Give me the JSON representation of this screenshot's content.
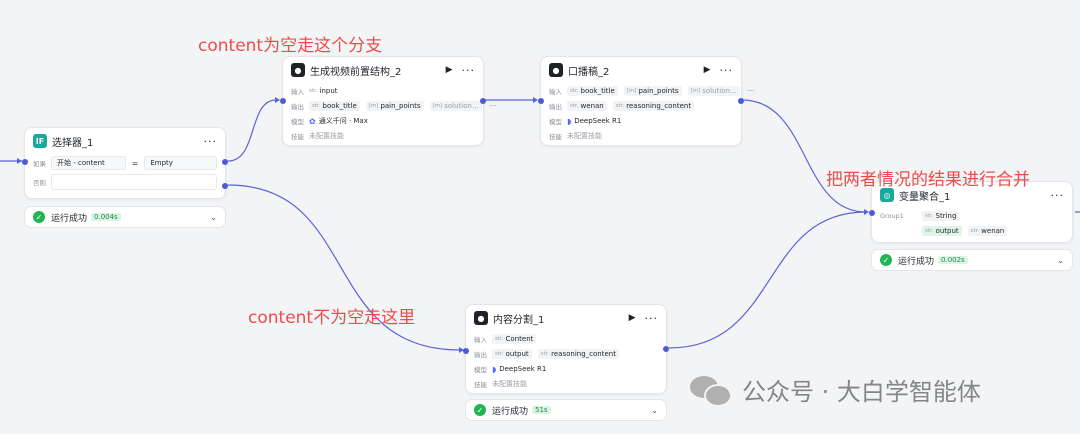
{
  "annotations": {
    "empty_branch": "content为空走这个分支",
    "not_empty_branch": "content不为空走这里",
    "merge": "把两者情况的结果进行合并"
  },
  "nodes": {
    "selector": {
      "title": "选择器_1",
      "icon": "if-icon",
      "if_label": "如果",
      "cond_left": "开始 - content",
      "cond_op": "=",
      "cond_right": "Empty",
      "else_label": "否则",
      "status": "运行成功",
      "time": "0.004s"
    },
    "gen": {
      "title": "生成视频前置结构_2",
      "input_label": "输入",
      "input_type": "str.",
      "input_name": "input",
      "output_label": "输出",
      "outputs": [
        {
          "type": "str.",
          "name": "book_title"
        },
        {
          "type": "[m]",
          "name": "pain_points"
        },
        {
          "type": "[m]",
          "name": "solution..."
        }
      ],
      "more": "···",
      "model_label": "模型",
      "model": "通义千问 · Max",
      "skill_label": "技能",
      "skill": "未配置技能"
    },
    "script": {
      "title": "口播稿_2",
      "input_label": "输入",
      "inputs": [
        {
          "type": "str.",
          "name": "book_title"
        },
        {
          "type": "[m]",
          "name": "pain_points"
        },
        {
          "type": "[m]",
          "name": "solution..."
        }
      ],
      "more": "···",
      "output_label": "输出",
      "outputs": [
        {
          "type": "str.",
          "name": "wenan"
        },
        {
          "type": "str.",
          "name": "reasoning_content"
        }
      ],
      "model_label": "模型",
      "model": "DeepSeek R1",
      "skill_label": "技能",
      "skill": "未配置技能"
    },
    "split": {
      "title": "内容分割_1",
      "input_label": "输入",
      "input_type": "str.",
      "input_name": "Content",
      "output_label": "输出",
      "outputs": [
        {
          "type": "str.",
          "name": "output"
        },
        {
          "type": "str.",
          "name": "reasoning_content"
        }
      ],
      "model_label": "模型",
      "model": "DeepSeek R1",
      "skill_label": "技能",
      "skill": "未配置技能",
      "status": "运行成功",
      "time": "51s"
    },
    "aggregate": {
      "title": "变量聚合_1",
      "group_label": "Group1",
      "group_type": "String",
      "vars": [
        {
          "type": "str.",
          "name": "output"
        },
        {
          "type": "str.",
          "name": "wenan"
        }
      ],
      "status": "运行成功",
      "time": "0.002s"
    }
  },
  "watermark": "公众号 · 大白学智能体",
  "colors": {
    "edge": "#5b64d6",
    "annotation": "#ee4b4b",
    "success": "#22b453",
    "accent_teal": "#16a99c"
  }
}
